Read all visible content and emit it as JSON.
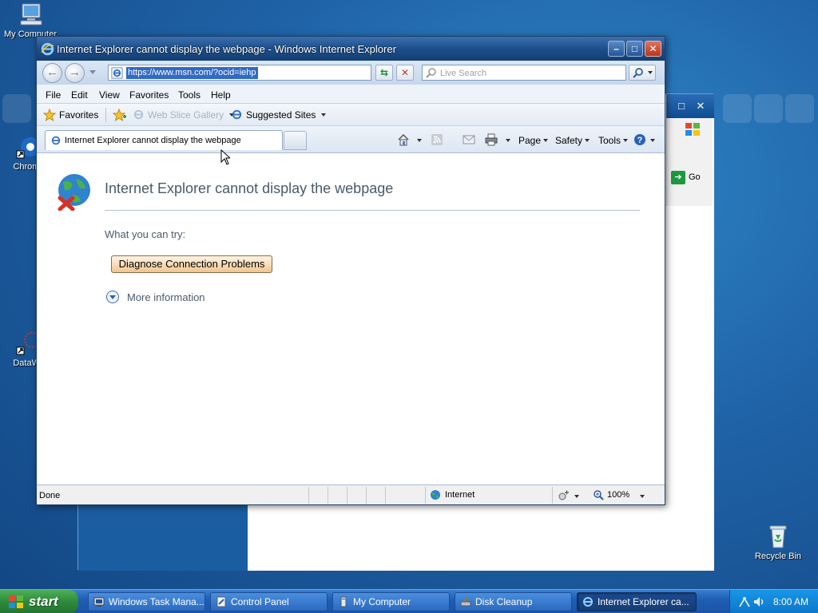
{
  "desktop": {
    "icons": [
      {
        "label": "My Computer"
      },
      {
        "label": "Chrome"
      },
      {
        "label": "DataWa"
      },
      {
        "label": "Recycle Bin"
      }
    ]
  },
  "background_window": {
    "go_label": "Go"
  },
  "ie": {
    "title": "Internet Explorer cannot display the webpage - Windows Internet Explorer",
    "address": "https://www.msn.com/?ocid=iehp",
    "search_placeholder": "Live Search",
    "menu": [
      "File",
      "Edit",
      "View",
      "Favorites",
      "Tools",
      "Help"
    ],
    "favorites_bar": {
      "favorites_label": "Favorites",
      "web_slice_label": "Web Slice Gallery",
      "suggested_label": "Suggested Sites"
    },
    "tab": {
      "label": "Internet Explorer cannot display the webpage"
    },
    "commands": {
      "page": "Page",
      "safety": "Safety",
      "tools": "Tools"
    },
    "content": {
      "error_title": "Internet Explorer cannot display the webpage",
      "try_label": "What you can try:",
      "diagnose_button": "Diagnose Connection Problems",
      "more_info": "More information"
    },
    "status": {
      "text": "Done",
      "zone": "Internet",
      "zoom": "100%"
    }
  },
  "taskbar": {
    "start_label": "start",
    "items": [
      {
        "label": "Windows Task Mana..."
      },
      {
        "label": "Control Panel"
      },
      {
        "label": "My Computer"
      },
      {
        "label": "Disk Cleanup"
      },
      {
        "label": "Internet Explorer ca..."
      }
    ],
    "clock": "8:00 AM"
  },
  "colors": {
    "desktop": "#1f62a6",
    "titlebar": "#1c4f8c",
    "start": "#2d8a3a",
    "selection": "#316ac5"
  }
}
